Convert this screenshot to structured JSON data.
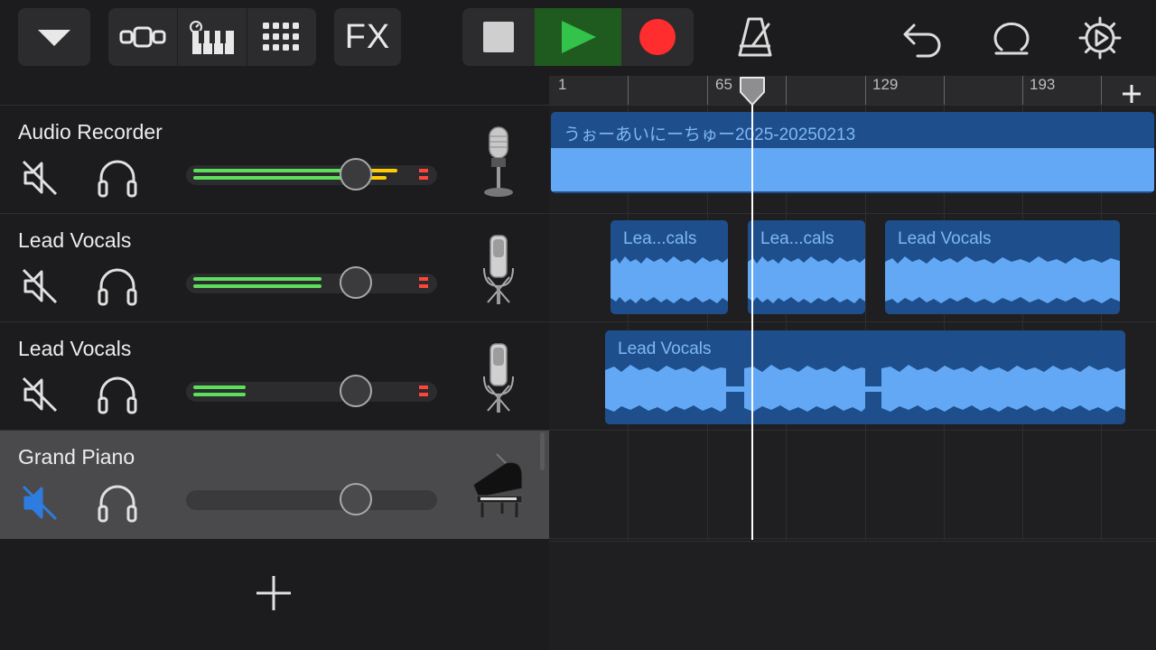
{
  "toolbar": {
    "fx_label": "FX"
  },
  "ruler": {
    "labels": [
      "1",
      "65",
      "129",
      "193"
    ]
  },
  "tracks": [
    {
      "name": "Audio Recorder",
      "instrument": "microphone-icon",
      "muted": false,
      "selected": false
    },
    {
      "name": "Lead Vocals",
      "instrument": "condenser-mic-icon",
      "muted": false,
      "selected": false
    },
    {
      "name": "Lead Vocals",
      "instrument": "condenser-mic-icon",
      "muted": false,
      "selected": false
    },
    {
      "name": "Grand Piano",
      "instrument": "grand-piano-icon",
      "muted": true,
      "selected": true
    }
  ],
  "regions": {
    "lane1": [
      {
        "label": "うぉーあいにーちゅー2025-20250213"
      }
    ],
    "lane2": [
      {
        "label": "Lea...cals"
      },
      {
        "label": "Lea...cals"
      },
      {
        "label": "Lead Vocals"
      }
    ],
    "lane3": [
      {
        "label": "Lead Vocals"
      }
    ]
  },
  "colors": {
    "accent_blue": "#2f7ce0",
    "region_fill": "#1e4f8c",
    "waveform": "#62a8f5",
    "play_green": "#33c24a",
    "record_red": "#ff2d2d",
    "meter_green": "#5ce05c",
    "meter_yellow": "#ffcc00"
  }
}
